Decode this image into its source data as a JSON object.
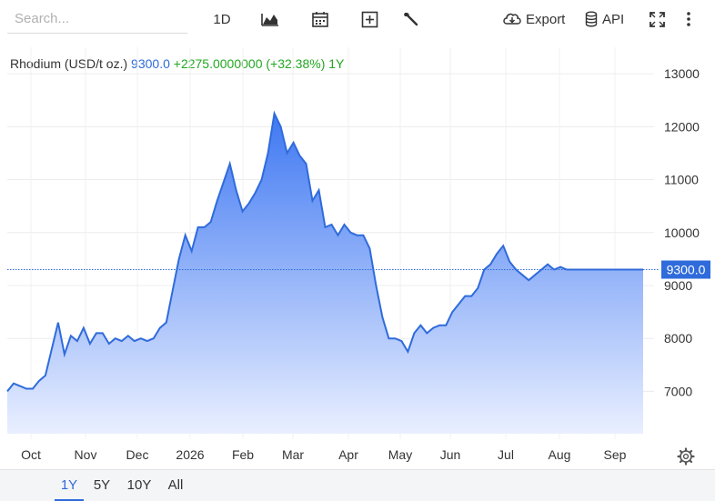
{
  "toolbar": {
    "search_placeholder": "Search...",
    "interval_label": "1D",
    "export_label": "Export",
    "api_label": "API",
    "icons": [
      "chart-type-icon",
      "calendar-icon",
      "add-indicator-icon",
      "wrench-icon",
      "cloud-download-icon",
      "database-icon",
      "fullscreen-icon",
      "more-vert-icon",
      "gear-icon"
    ]
  },
  "legend": {
    "name": "Rhodium (USD/t oz.)",
    "value": "9300.0",
    "change": "+2275.0000000 (+32.38%) 1Y"
  },
  "price_badge": "9300.0",
  "ranges": {
    "items": [
      "1Y",
      "5Y",
      "10Y",
      "All"
    ],
    "active": "1Y"
  },
  "colors": {
    "line": "#2f6bdb",
    "area_top": "#3f78f2",
    "area_bottom": "#e9efff",
    "change_positive": "#22a822",
    "badge_bg": "#2f6bdb"
  },
  "chart_data": {
    "type": "area",
    "title": "Rhodium (USD/t oz.)",
    "ylim": [
      6200,
      13500
    ],
    "y_ticks": [
      7000,
      8000,
      9000,
      10000,
      11000,
      12000,
      13000
    ],
    "x_ticks": [
      "Oct",
      "Nov",
      "Dec",
      "2026",
      "Feb",
      "Mar",
      "Apr",
      "May",
      "Jun",
      "Jul",
      "Aug",
      "Sep"
    ],
    "current_value": 9300,
    "grid": true,
    "series": [
      {
        "x": [
          "Sep 25",
          "Oct 1",
          "Oct 4",
          "Oct 8",
          "Oct 13",
          "Oct 17",
          "Oct 22",
          "Oct 24",
          "Oct 27",
          "Oct 30",
          "Nov 1",
          "Nov 4",
          "Nov 8",
          "Nov 11",
          "Nov 14",
          "Nov 18",
          "Nov 22",
          "Nov 27",
          "Dec 1",
          "Dec 6",
          "Dec 10",
          "Dec 16",
          "Dec 22",
          "Dec 27",
          "Dec 31",
          "Jan 1",
          "Jan 4",
          "Jan 6",
          "Jan 9",
          "Jan 13",
          "Jan 17",
          "Jan 20",
          "Jan 23",
          "Jan 25",
          "Jan 27",
          "Jan 29",
          "Jan 31",
          "Feb 3",
          "Feb 6",
          "Feb 10",
          "Feb 14",
          "Feb 17",
          "Feb 19",
          "Feb 22",
          "Feb 24",
          "Feb 26",
          "Feb 28",
          "Mar 1",
          "Mar 3",
          "Mar 5",
          "Mar 7",
          "Mar 10",
          "Mar 12",
          "Mar 15",
          "Mar 17",
          "Mar 20",
          "Mar 24",
          "Mar 27",
          "Apr 1",
          "Apr 4",
          "Apr 8",
          "Apr 12",
          "Apr 16",
          "Apr 20",
          "Apr 25",
          "May 1",
          "May 6",
          "May 12",
          "May 17",
          "May 21",
          "May 25",
          "May 28",
          "Jun 2",
          "Jun 5",
          "Jun 10",
          "Jun 15",
          "Jun 20",
          "Jun 24",
          "Jun 28",
          "Jul 2",
          "Jul 6",
          "Jul 9",
          "Jul 13",
          "Jul 17",
          "Jul 21",
          "Jul 26",
          "Aug 1",
          "Aug 4",
          "Aug 8",
          "Aug 12",
          "Aug 16",
          "Aug 20",
          "Aug 25",
          "Aug 30",
          "Sep 2",
          "Sep 5",
          "Sep 8",
          "Sep 11",
          "Sep 14",
          "Sep 17",
          "Sep 19"
        ],
        "values": [
          7000,
          7150,
          7100,
          7050,
          7050,
          7200,
          7300,
          7800,
          8300,
          7700,
          8050,
          7950,
          8200,
          7900,
          8100,
          8100,
          7900,
          8000,
          7950,
          8050,
          7950,
          8000,
          7950,
          8000,
          8200,
          8300,
          8900,
          9500,
          9950,
          9650,
          10100,
          10100,
          10200,
          10600,
          10950,
          11300,
          10800,
          10400,
          10550,
          10750,
          11000,
          11500,
          12250,
          12000,
          11500,
          11700,
          11450,
          11300,
          10600,
          10800,
          10100,
          10150,
          9950,
          10150,
          10000,
          9950,
          9950,
          9700,
          9000,
          8400,
          8000,
          8000,
          7950,
          7750,
          8100,
          8250,
          8100,
          8200,
          8250,
          8250,
          8500,
          8650,
          8800,
          8800,
          8950,
          9300,
          9400,
          9600,
          9750,
          9450,
          9300,
          9200,
          9100,
          9200,
          9300,
          9400,
          9300,
          9350,
          9300,
          9300,
          9300,
          9300,
          9300,
          9300,
          9300,
          9300,
          9300,
          9300,
          9300,
          9300,
          9300
        ]
      }
    ]
  }
}
